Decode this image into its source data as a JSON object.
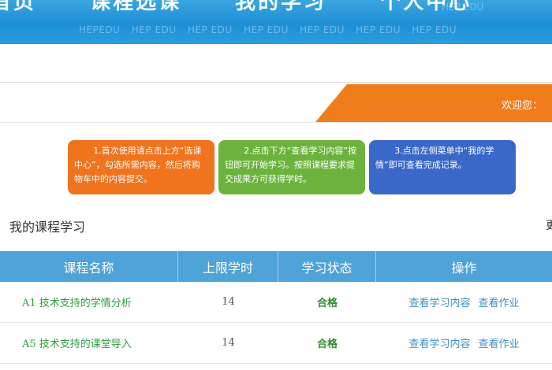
{
  "banner": {
    "nav_items": [
      "首页",
      "课程选课",
      "我的学习",
      "个人中心"
    ],
    "watermark": [
      "HEPEDU",
      "HEP EDU",
      "HEP EDU",
      "HEP EDU",
      "HEP EDU",
      "HEP EDU",
      "HEP EDU"
    ],
    "watermark_right": "HEP EDU"
  },
  "welcome": {
    "text": "欢迎您："
  },
  "instructions": [
    "1.首次使用请点击上方“选课中心”，勾选所需内容，然后将购物车中的内容提交。",
    "2.点击下方“查看学习内容”按钮即可开始学习。按照课程要求提交成果方可获得学时。",
    "3.点击左侧菜单中“我的学情”即可查看完成记录。"
  ],
  "section": {
    "title": "我的课程学习",
    "more": "更"
  },
  "table": {
    "headers": [
      "课程名称",
      "上限学时",
      "学习状态",
      "操作"
    ],
    "rows": [
      {
        "course": "A1 技术支持的学情分析",
        "hours": "14",
        "status": "合格",
        "op1": "查看学习内容",
        "op2": "查看作业"
      },
      {
        "course": "A5 技术支持的课堂导入",
        "hours": "14",
        "status": "合格",
        "op1": "查看学习内容",
        "op2": "查看作业"
      }
    ]
  },
  "colors": {
    "banner": "#1e8fd6",
    "welcome_bar": "#f07d1b",
    "card_orange": "#f0731d",
    "card_green": "#6cb33e",
    "card_blue": "#3a68c9",
    "table_header": "#4ea3d8",
    "status_ok": "#2e8b2e"
  }
}
